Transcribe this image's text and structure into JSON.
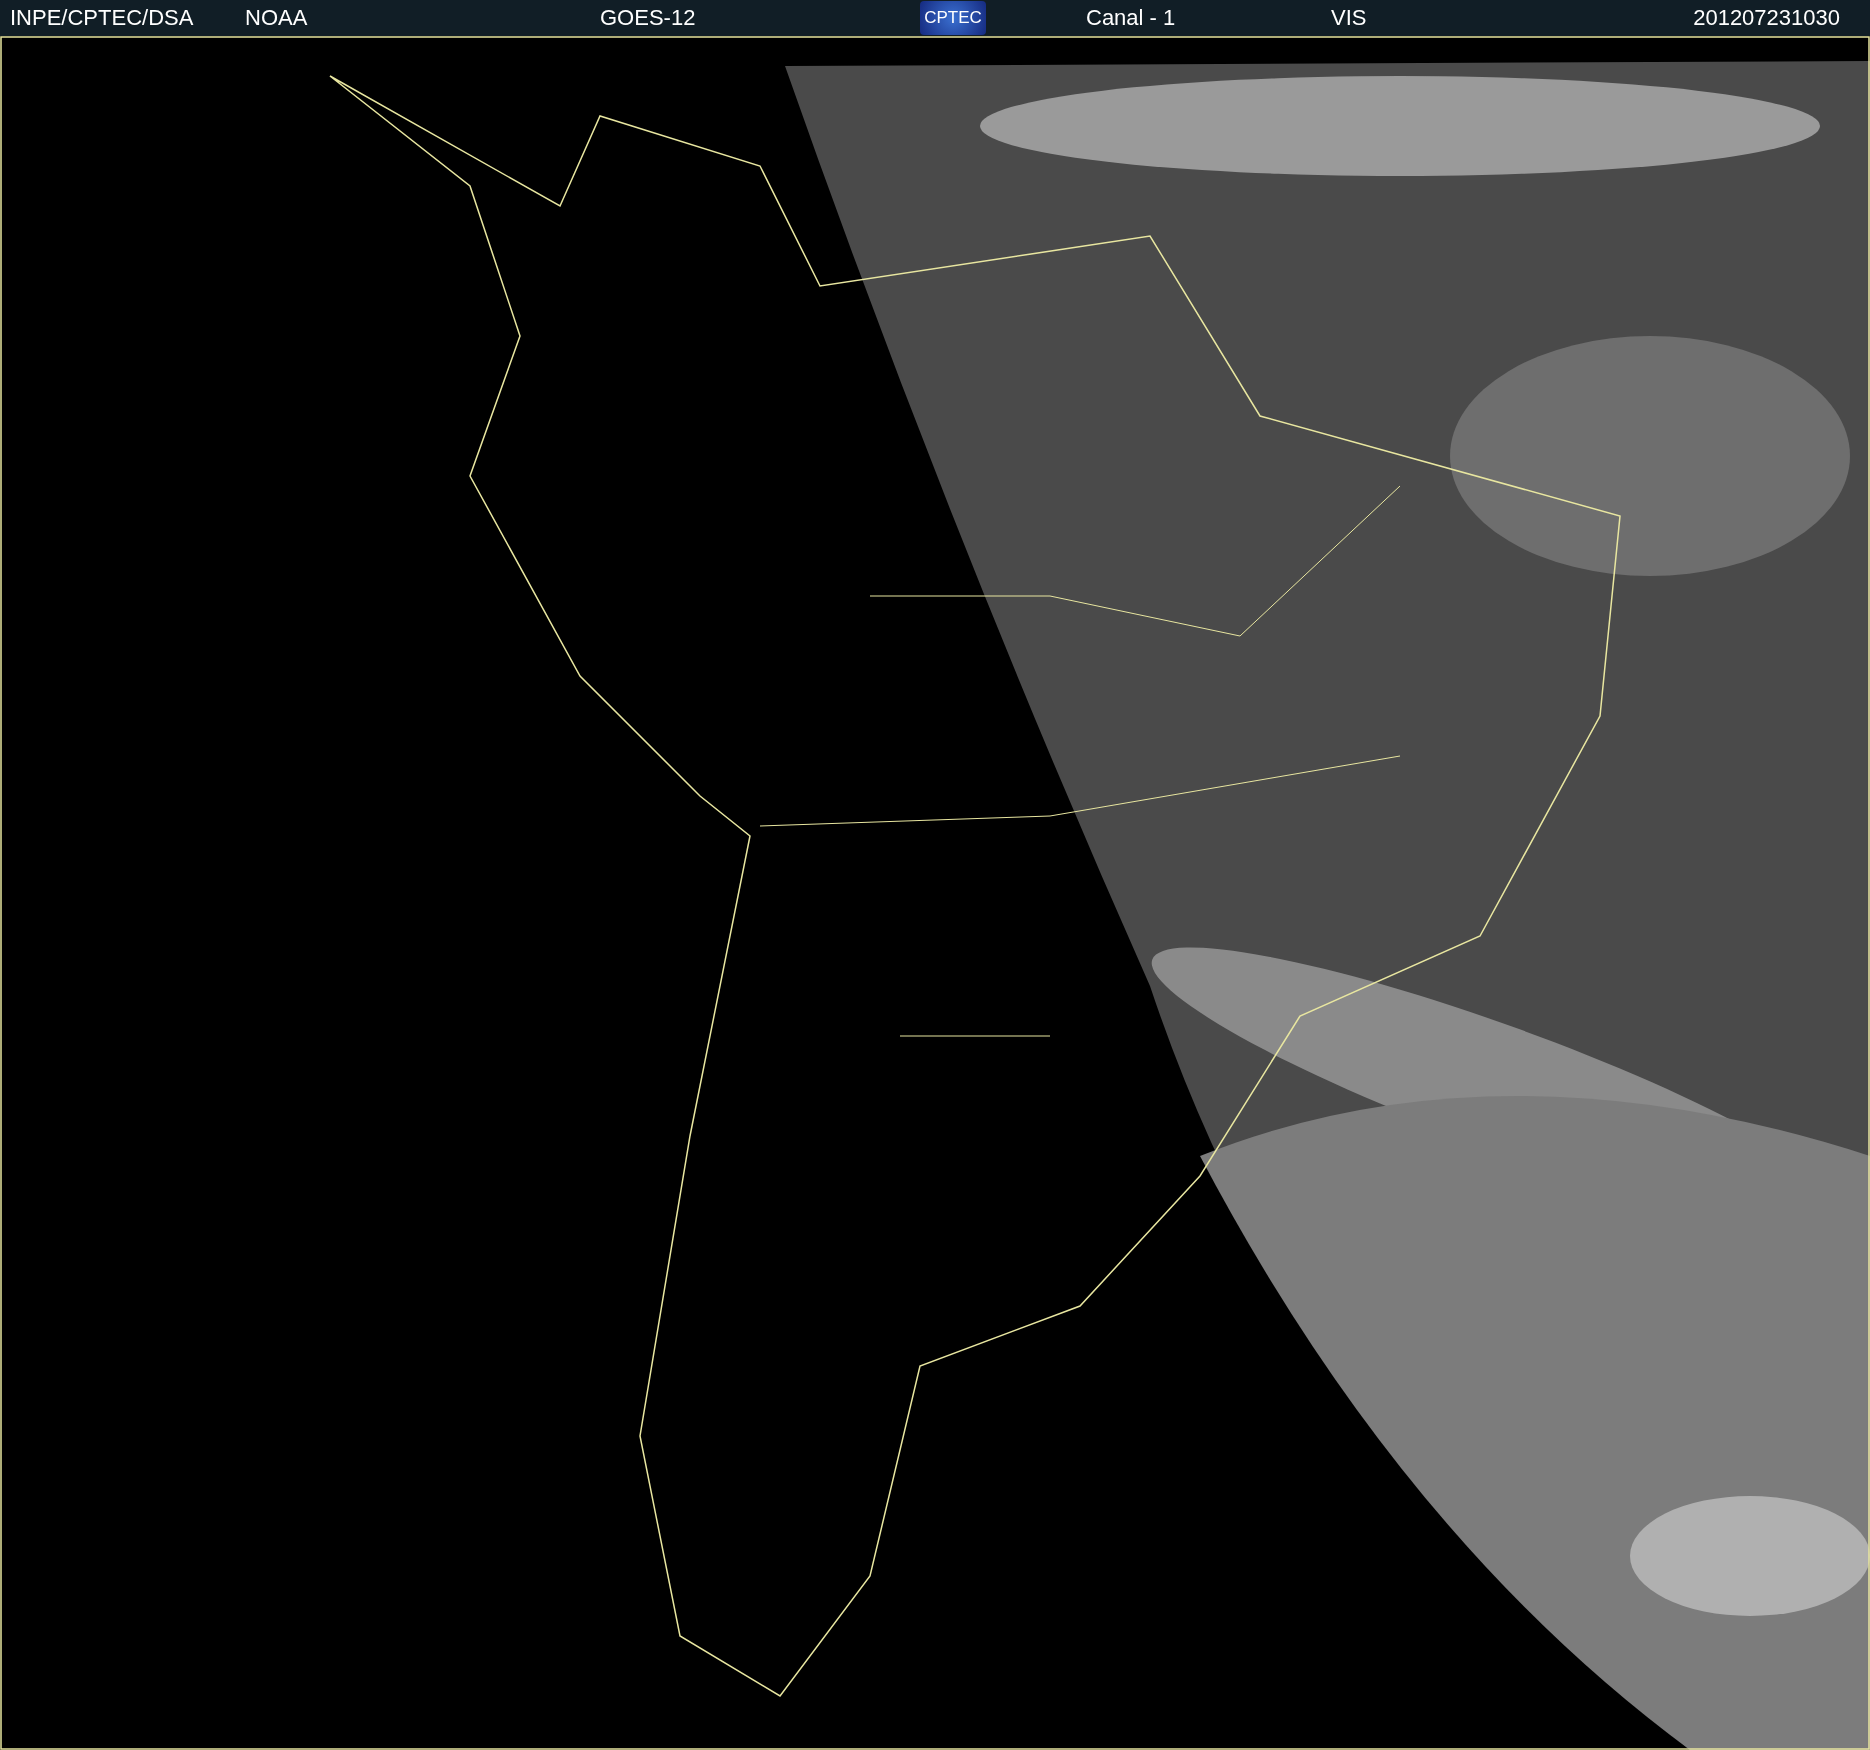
{
  "header": {
    "items": [
      {
        "text": "INPE/CPTEC/DSA"
      },
      {
        "text": "NOAA"
      },
      {
        "text": "GOES-12"
      }
    ],
    "logo": "CPTEC",
    "items_after_logo": [
      {
        "text": "Canal - 1"
      },
      {
        "text": "VIS"
      },
      {
        "text": "201207231030"
      }
    ]
  }
}
